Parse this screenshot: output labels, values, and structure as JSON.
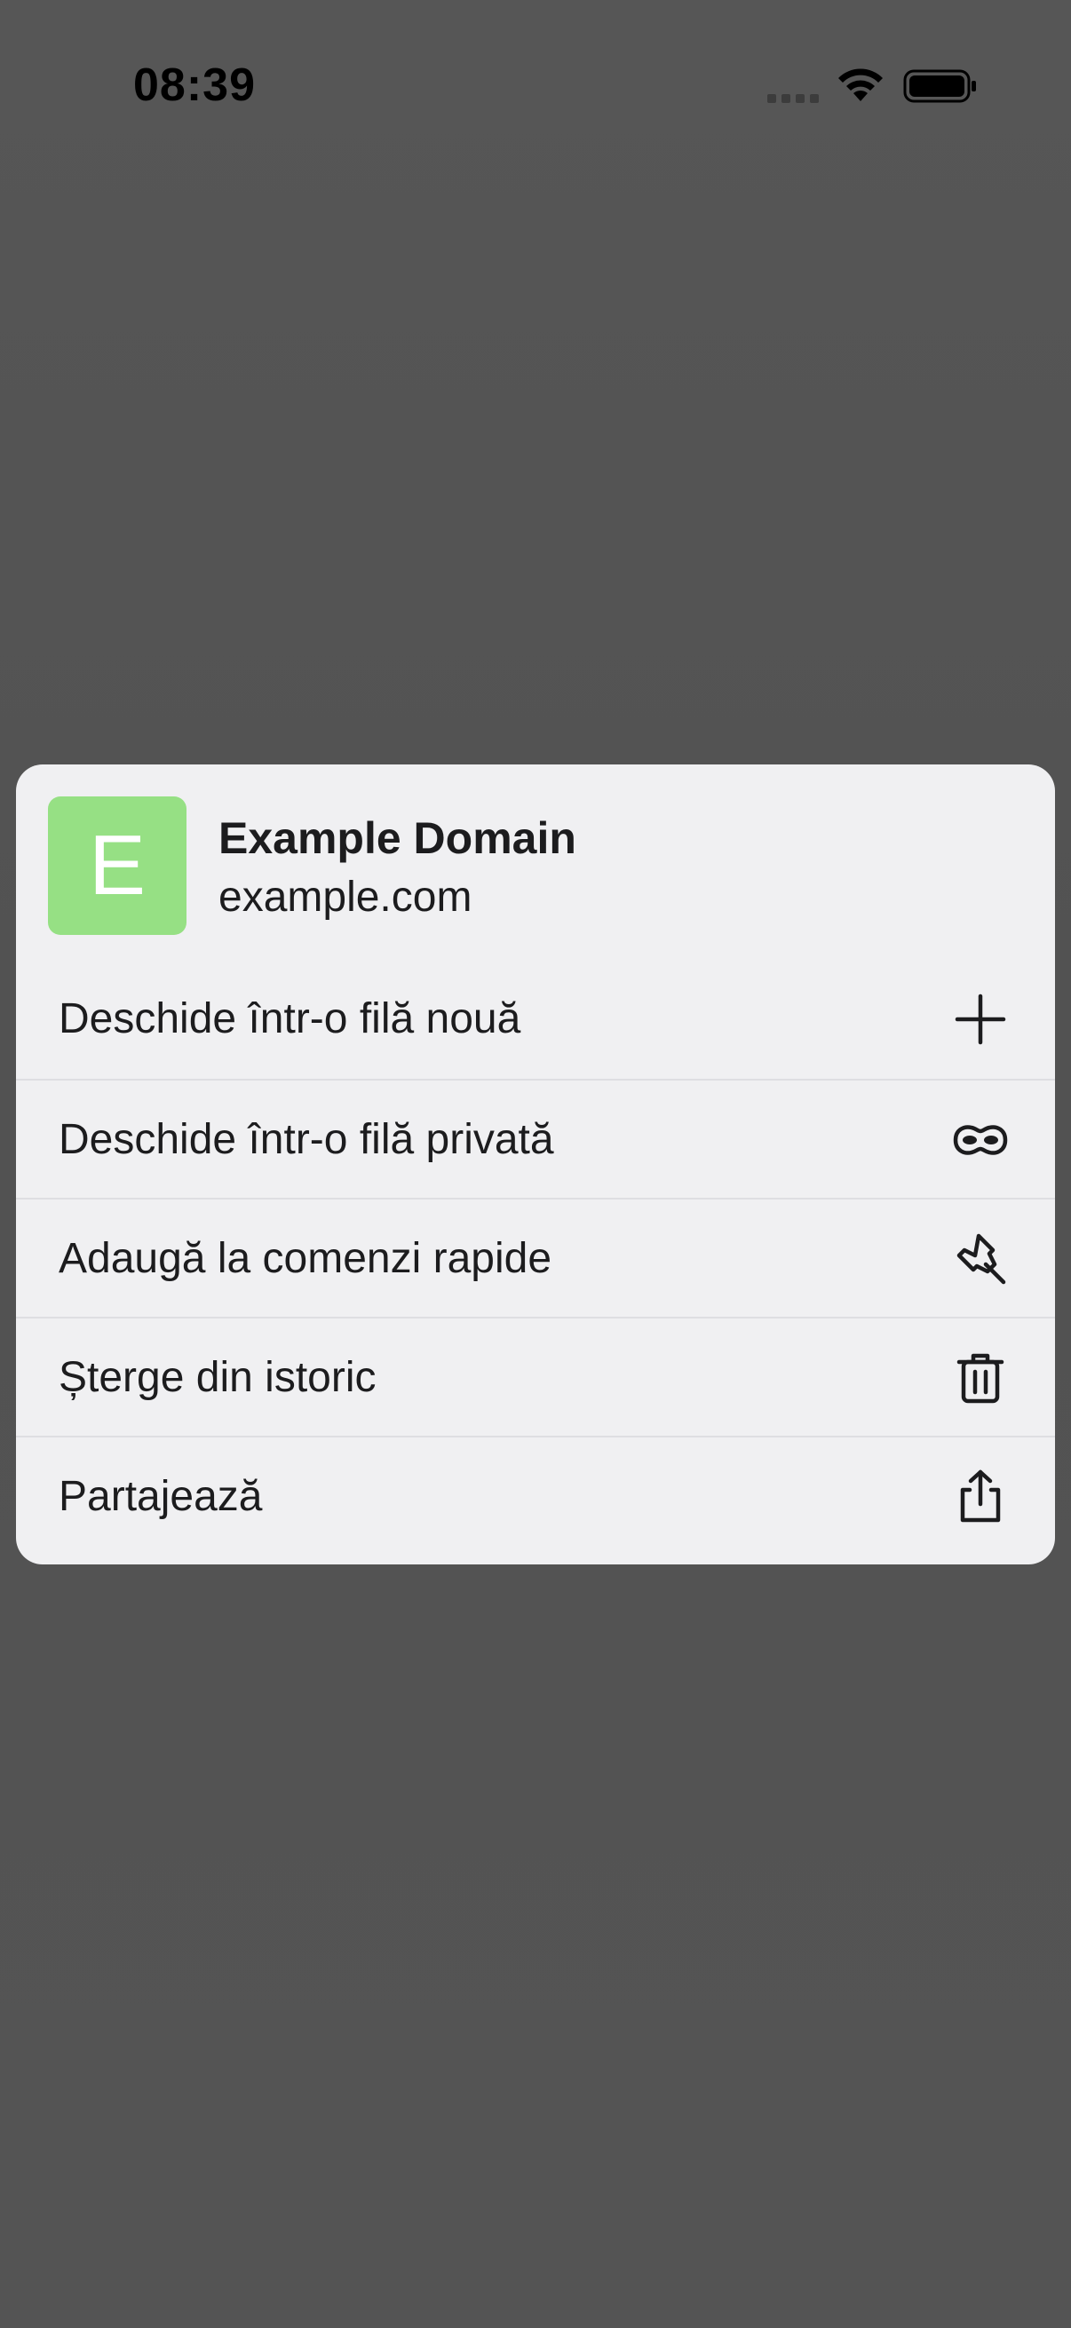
{
  "status_bar": {
    "time": "08:39",
    "icons": [
      "cellular-signal-icon",
      "wifi-icon",
      "battery-icon"
    ]
  },
  "context_menu": {
    "site": {
      "favicon_letter": "E",
      "favicon_color": "#96e084",
      "title": "Example Domain",
      "url": "example.com"
    },
    "items": [
      {
        "label": "Deschide într-o filă nouă",
        "icon": "plus-icon"
      },
      {
        "label": "Deschide într-o filă privată",
        "icon": "private-mask-icon"
      },
      {
        "label": "Adaugă la comenzi rapide",
        "icon": "pin-icon"
      },
      {
        "label": "Șterge din istoric",
        "icon": "trash-icon"
      },
      {
        "label": "Partajează",
        "icon": "share-icon"
      }
    ]
  },
  "colors": {
    "backdrop": "#545454",
    "menu_background": "#f0f0f2",
    "separator": "#dedee2",
    "text": "#1c1c1e"
  }
}
